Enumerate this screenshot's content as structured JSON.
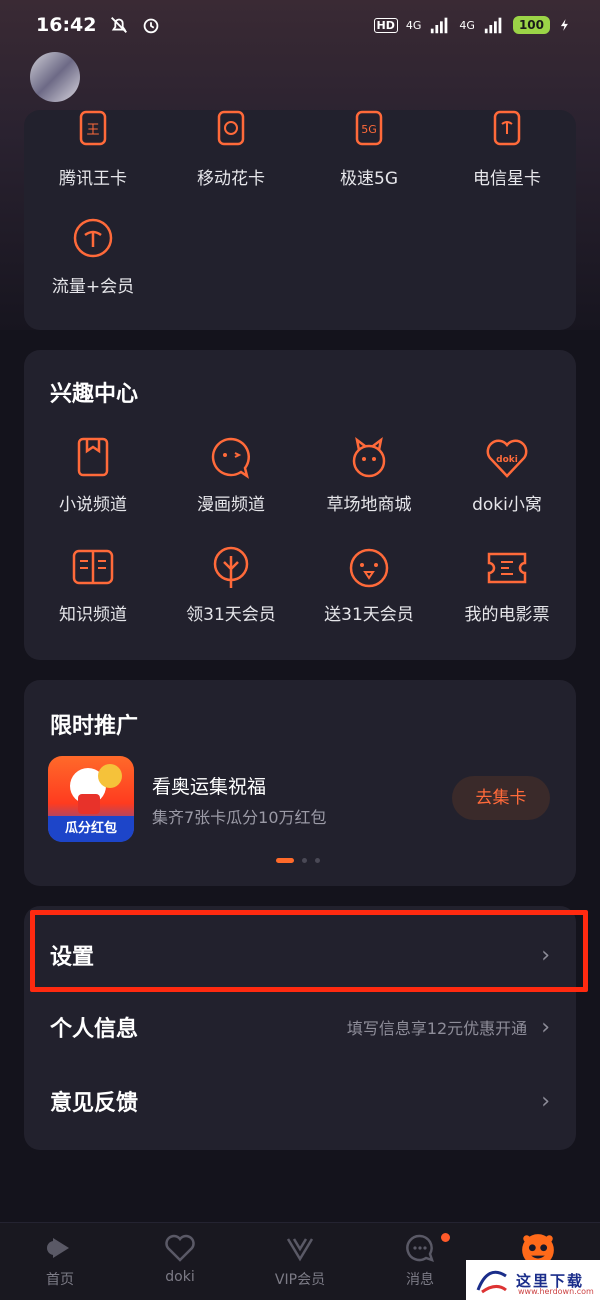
{
  "status_bar": {
    "time": "16:42",
    "battery": "100",
    "signal1": "4G",
    "signal2": "4G",
    "hd": "HD"
  },
  "carrier_grid": {
    "items": [
      {
        "label": "腾讯王卡",
        "icon": "tencent-king-card-icon"
      },
      {
        "label": "移动花卡",
        "icon": "mobile-flower-card-icon"
      },
      {
        "label": "极速5G",
        "icon": "fast-5g-icon"
      },
      {
        "label": "电信星卡",
        "icon": "telecom-star-card-icon"
      },
      {
        "label": "流量+会员",
        "icon": "data-plus-member-icon"
      }
    ]
  },
  "interest_center": {
    "title": "兴趣中心",
    "items": [
      {
        "label": "小说频道",
        "icon": "novel-icon"
      },
      {
        "label": "漫画频道",
        "icon": "comic-icon"
      },
      {
        "label": "草场地商城",
        "icon": "mall-icon"
      },
      {
        "label": "doki小窝",
        "icon": "doki-heart-icon"
      },
      {
        "label": "知识频道",
        "icon": "knowledge-icon"
      },
      {
        "label": "领31天会员",
        "icon": "claim-member-icon"
      },
      {
        "label": "送31天会员",
        "icon": "gift-member-icon"
      },
      {
        "label": "我的电影票",
        "icon": "movie-ticket-icon"
      }
    ]
  },
  "promotion": {
    "title": "限时推广",
    "item_title": "看奥运集祝福",
    "item_subtitle": "集齐7张卡瓜分10万红包",
    "thumb_badge": "瓜分红包",
    "button_label": "去集卡",
    "carousel_active_index": 0
  },
  "menu": {
    "settings": "设置",
    "personal_info": "个人信息",
    "personal_info_hint": "填写信息享12元优惠开通",
    "feedback": "意见反馈",
    "chevron": "›"
  },
  "tabbar": {
    "items": [
      {
        "label": "首页",
        "icon": "home-play-icon"
      },
      {
        "label": "doki",
        "icon": "doki-icon"
      },
      {
        "label": "VIP会员",
        "icon": "vip-crown-icon"
      },
      {
        "label": "消息",
        "icon": "message-icon"
      },
      {
        "label": "",
        "icon": "profile-face-icon"
      }
    ],
    "active_color": "#ff6a1a",
    "badge_color": "#ff5a2a"
  },
  "watermark": {
    "text": "这里下载",
    "url": "www.herdown.com"
  },
  "colors": {
    "accent": "#ff6a3a",
    "highlight_border": "#ff2a10",
    "card_bg": "#22212d"
  }
}
